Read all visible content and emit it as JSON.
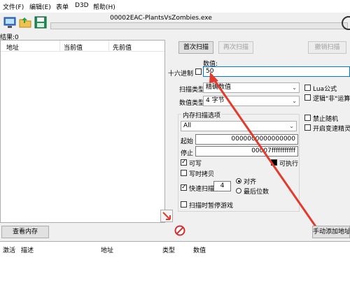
{
  "menu": [
    "文件(F)",
    "编辑(E)",
    "表单",
    "D3D",
    "帮助(H)"
  ],
  "process_title": "00002EAC-PlantsVsZombies.exe",
  "found_label": "结果:0",
  "list_headers": [
    "地址",
    "当前值",
    "先前值"
  ],
  "buttons": {
    "first_scan": "首次扫描",
    "next_scan": "再次扫描",
    "undo_scan": "撤销扫描",
    "view_memory": "查看内存",
    "add_address": "手动添加地址"
  },
  "value": {
    "label": "数值:",
    "hex_label": "十六进制",
    "input": "50"
  },
  "scan_type": {
    "label": "扫描类型",
    "selected": "精确数值"
  },
  "value_type": {
    "label": "数值类型",
    "selected": "4 字节"
  },
  "options_right": {
    "lua": "Lua公式",
    "not": "逻辑\"非\"运算",
    "no_random": "禁止随机",
    "speedhack": "开启变速精灵"
  },
  "memory_options": {
    "title": "内存扫描选项",
    "region": "All",
    "start_label": "起始",
    "start_value": "0000000000000000",
    "stop_label": "停止",
    "stop_value": "00007fffffffffff",
    "writable": "可写",
    "executable": "可执行",
    "copy_on_write": "写时拷贝",
    "fast_scan": "快速扫描",
    "fast_scan_value": "4",
    "align": "对齐",
    "last_digits": "最后位数",
    "pause_game": "扫描时暂停游戏"
  },
  "bottom_headers": [
    "激活",
    "描述",
    "地址",
    "类型",
    "数值"
  ],
  "colors": {
    "arrow": "#e23b2e",
    "accent": "#0078d7"
  }
}
